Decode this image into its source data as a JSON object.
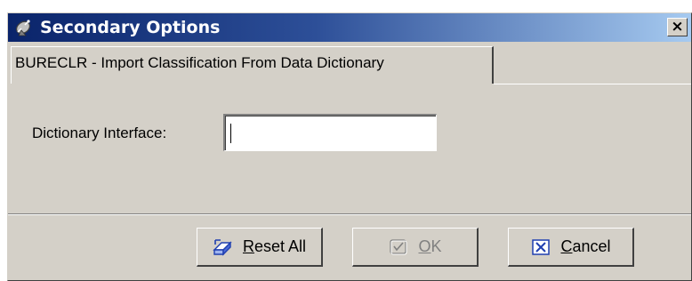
{
  "window": {
    "title": "Secondary Options",
    "title_icon": "satellite-dish-icon",
    "close_glyph": "×"
  },
  "tab": {
    "label": "BURECLR - Import Classification From Data Dictionary"
  },
  "form": {
    "dictionary_interface_label": "Dictionary Interface:",
    "dictionary_interface_value": ""
  },
  "buttons": {
    "reset_all": {
      "mnemonic": "R",
      "rest": "eset All",
      "icon": "eraser-icon"
    },
    "ok": {
      "mnemonic": "O",
      "rest": "K",
      "icon": "checkmark-icon",
      "enabled": false
    },
    "cancel": {
      "mnemonic": "C",
      "rest": "ancel",
      "icon": "x-box-icon"
    }
  },
  "colors": {
    "title_gradient_start": "#0a246a",
    "title_gradient_end": "#a6caf0",
    "face": "#d4d0c8",
    "disabled_text": "#808080"
  }
}
